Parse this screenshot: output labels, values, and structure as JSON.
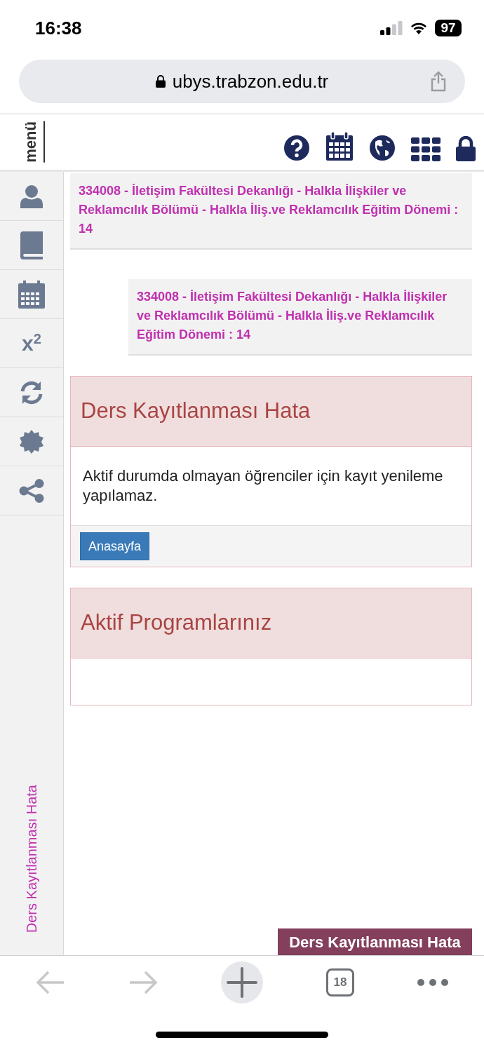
{
  "status_bar": {
    "time": "16:38",
    "battery": "97"
  },
  "browser": {
    "url": "ubys.trabzon.edu.tr",
    "tab_count": "18"
  },
  "header": {
    "menu_label": "menü"
  },
  "sidebar": {
    "superscript_label": "x$^{2}$",
    "vertical_title": "Ders Kayıtlanması Hata"
  },
  "program_boxes": [
    "334008 - İletişim Fakültesi Dekanlığı - Halkla İlişkiler ve Reklamcılık Bölümü - Halkla İliş.ve Reklamcılık Eğitim Dönemi : 14",
    "334008 - İletişim Fakültesi Dekanlığı - Halkla İlişkiler ve Reklamcılık Bölümü - Halkla İliş.ve Reklamcılık Eğitim Dönemi : 14"
  ],
  "panels": [
    {
      "title": "Ders Kayıtlanması Hata",
      "body": "Aktif durumda olmayan öğrenciler için kayıt yenileme yapılamaz.",
      "button": "Anasayfa"
    },
    {
      "title": "Aktif Programlarınız"
    }
  ],
  "footer_tag": "Ders Kayıtlanması Hata"
}
